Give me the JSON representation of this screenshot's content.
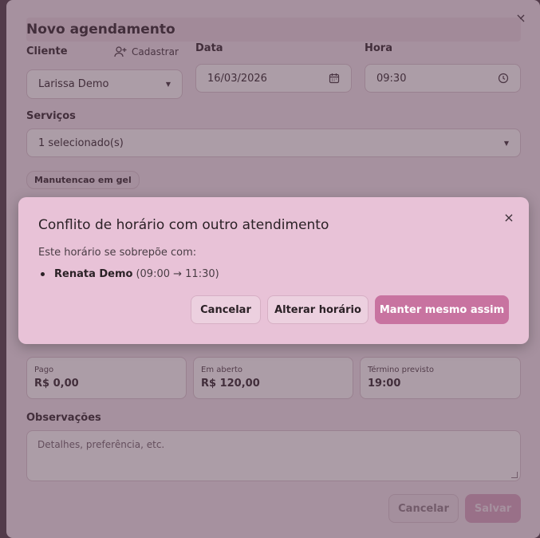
{
  "form": {
    "title": "Novo agendamento",
    "close_icon": "×",
    "client": {
      "label": "Cliente",
      "register_label": "Cadastrar",
      "value": "Larissa Demo"
    },
    "date": {
      "label": "Data",
      "value": "16/03/2026"
    },
    "time": {
      "label": "Hora",
      "value": "09:30"
    },
    "services": {
      "label": "Serviços",
      "value": "1 selecionado(s)",
      "chips": [
        "Manutencao em gel"
      ]
    },
    "summary": [
      {
        "label": "Pago",
        "value": "R$ 0,00"
      },
      {
        "label": "Em aberto",
        "value": "R$ 120,00"
      },
      {
        "label": "Término previsto",
        "value": "19:00"
      }
    ],
    "notes": {
      "label": "Observações",
      "placeholder": "Detalhes, preferência, etc."
    },
    "cancel_label": "Cancelar",
    "save_label": "Salvar"
  },
  "conflict_dialog": {
    "title": "Conflito de horário com outro atendimento",
    "close_icon": "×",
    "subtitle": "Este horário se sobrepõe com:",
    "conflicts": [
      {
        "name": "Renata Demo",
        "time": "(09:00 → 11:30)"
      }
    ],
    "buttons": {
      "cancel": "Cancelar",
      "change": "Alterar horário",
      "keep": "Manter mesmo assim"
    }
  },
  "colors": {
    "accent": "#c873a0",
    "modal_bg": "#e8c2d7",
    "overlay": "#5a3c50"
  }
}
